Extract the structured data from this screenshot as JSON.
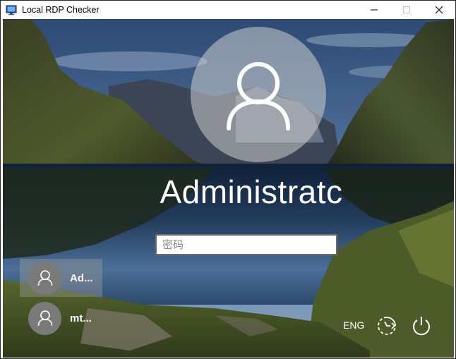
{
  "window": {
    "title": "Local RDP Checker"
  },
  "lock_screen": {
    "username": "Administratc",
    "password": {
      "value": "",
      "placeholder": "密码"
    },
    "users": [
      {
        "label": "Ad...",
        "selected": true
      },
      {
        "label": "mt...",
        "selected": false
      }
    ],
    "language": "ENG"
  },
  "icons": {
    "app": "monitor-icon",
    "minimize": "minimize-icon",
    "maximize": "maximize-icon",
    "close": "close-icon",
    "avatar": "user-avatar-icon",
    "accessibility": "ease-of-access-icon",
    "power": "power-icon"
  },
  "colors": {
    "titlebar": "#ffffff",
    "avatar_circle": "#cdcdcd",
    "user_tile_selected": "#969696",
    "text_light": "#ffffff"
  }
}
